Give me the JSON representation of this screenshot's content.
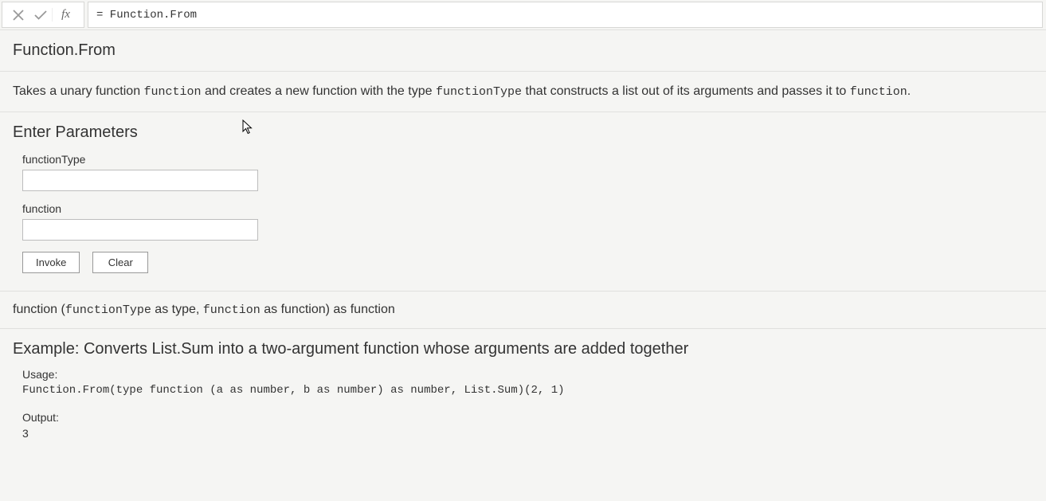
{
  "formulaBar": {
    "fxLabel": "fx",
    "formula": "= Function.From"
  },
  "header": {
    "title": "Function.From"
  },
  "description": {
    "pre": "Takes a unary function ",
    "code1": "function",
    "mid1": " and creates a new function with the type ",
    "code2": "functionType",
    "mid2": " that constructs a list out of its arguments and passes it to ",
    "code3": "function",
    "post": "."
  },
  "parameters": {
    "heading": "Enter Parameters",
    "items": [
      {
        "label": "functionType",
        "value": ""
      },
      {
        "label": "function",
        "value": ""
      }
    ],
    "invokeLabel": "Invoke",
    "clearLabel": "Clear"
  },
  "signature": {
    "pre": "function (",
    "p1": "functionType",
    "p1type": " as type",
    "sep": ", ",
    "p2": "function",
    "p2type": " as function) as function"
  },
  "example": {
    "titlePrefix": "Example: ",
    "titleText": "Converts List.Sum into a two-argument function whose arguments are added together",
    "usageLabel": "Usage:",
    "usageCode": "Function.From(type function (a as number, b as number) as number, List.Sum)(2, 1)",
    "outputLabel": "Output:",
    "outputValue": "3"
  }
}
